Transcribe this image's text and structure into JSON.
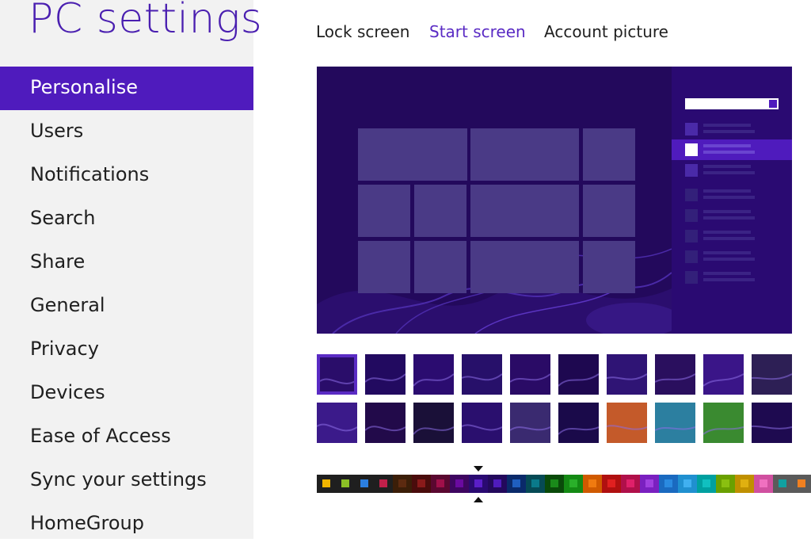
{
  "app": {
    "title": "PC settings"
  },
  "sidebar": {
    "items": [
      {
        "label": "Personalise",
        "selected": true
      },
      {
        "label": "Users"
      },
      {
        "label": "Notifications"
      },
      {
        "label": "Search"
      },
      {
        "label": "Share"
      },
      {
        "label": "General"
      },
      {
        "label": "Privacy"
      },
      {
        "label": "Devices"
      },
      {
        "label": "Ease of Access"
      },
      {
        "label": "Sync your settings"
      },
      {
        "label": "HomeGroup"
      }
    ]
  },
  "tabs": [
    {
      "label": "Lock screen"
    },
    {
      "label": "Start screen",
      "active": true
    },
    {
      "label": "Account picture"
    }
  ],
  "colors": {
    "accent": "#4f1bbd",
    "title": "#4a1fb0",
    "active_tab": "#5a2bc4",
    "preview_bg": "#23095c",
    "charm_bg": "#2a0a72",
    "tile": "#4a3a86"
  },
  "backgrounds": {
    "selected_index": 0,
    "row1": [
      "#2a0d6a",
      "#220a60",
      "#2b0c70",
      "#27106a",
      "#2a0b66",
      "#1e0850",
      "#2f1475",
      "#2a0f5e",
      "#3a1588",
      "#2d1f55"
    ],
    "row2": [
      "#3b1a8a",
      "#220a4a",
      "#1a1038",
      "#2a0f6e",
      "#3a2a70",
      "#1a0a4a",
      "#c45a2a",
      "#2c7fa0",
      "#3a8a30",
      "#1e0a50"
    ]
  },
  "color_swatches": [
    {
      "dot": "#f0b400",
      "bg": "#1f1f1f"
    },
    {
      "dot": "#8cbf26",
      "bg": "#1f1f1f"
    },
    {
      "dot": "#2b7fe0",
      "bg": "#1f1f1f"
    },
    {
      "dot": "#c0204a",
      "bg": "#1f1f1f"
    },
    {
      "dot": "#5c2a10",
      "bg": "#3b1e08"
    },
    {
      "dot": "#8a1a1a",
      "bg": "#4a0c0c"
    },
    {
      "dot": "#a0104a",
      "bg": "#5a0830"
    },
    {
      "dot": "#6a0aa0",
      "bg": "#3e0660"
    },
    {
      "dot": "#5a1ec8",
      "bg": "#2a0a72"
    },
    {
      "dot": "#4f1bbd",
      "bg": "#23095c",
      "selected": true
    },
    {
      "dot": "#1f5fc0",
      "bg": "#0a2a6a"
    },
    {
      "dot": "#0a7a8a",
      "bg": "#064a55"
    },
    {
      "dot": "#1a8a1a",
      "bg": "#0a4a0a"
    },
    {
      "dot": "#2ab02a",
      "bg": "#148a14"
    },
    {
      "dot": "#f07a10",
      "bg": "#d05a00"
    },
    {
      "dot": "#e02020",
      "bg": "#b01010"
    },
    {
      "dot": "#e0206a",
      "bg": "#b0104a"
    },
    {
      "dot": "#a040e0",
      "bg": "#7a20c0"
    },
    {
      "dot": "#2a8ae0",
      "bg": "#1a6ac0"
    },
    {
      "dot": "#40b0f0",
      "bg": "#2090d0"
    },
    {
      "dot": "#10c0c0",
      "bg": "#00a0a0"
    },
    {
      "dot": "#8ac010",
      "bg": "#6aa000"
    },
    {
      "dot": "#e0b010",
      "bg": "#c09000"
    },
    {
      "dot": "#f070c0",
      "bg": "#d050a0"
    },
    {
      "dot": "#10a0a0",
      "bg": "#5a5a5a"
    },
    {
      "dot": "#f08020",
      "bg": "#5a5a5a"
    }
  ]
}
